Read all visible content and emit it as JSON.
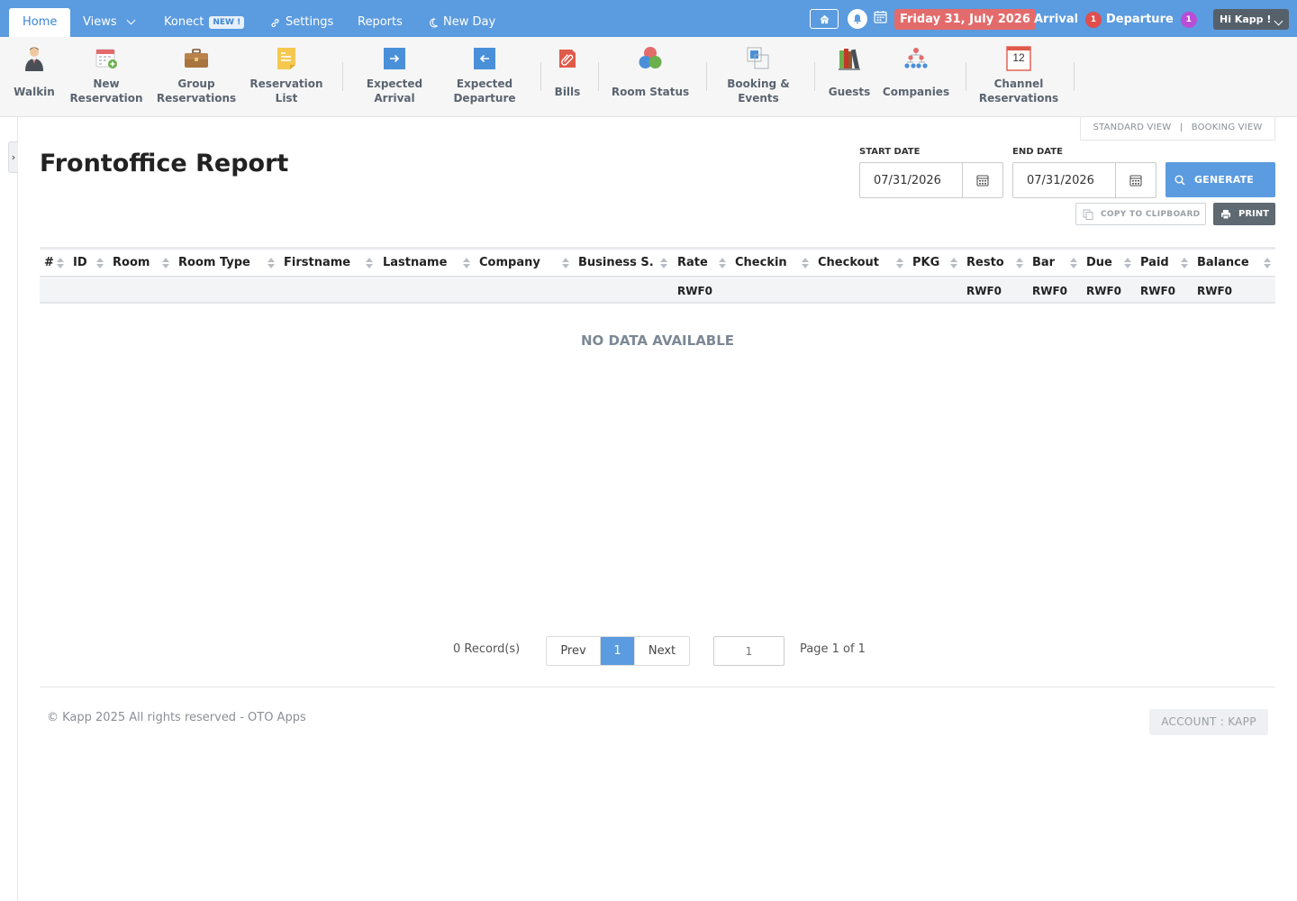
{
  "nav": {
    "tabs": [
      {
        "label": "Home"
      },
      {
        "label": "Views"
      },
      {
        "label": "Konect",
        "badge": "NEW !"
      },
      {
        "label": "Settings",
        "icon": "link-icon"
      },
      {
        "label": "Reports"
      },
      {
        "label": "New Day",
        "icon": "moon-icon"
      }
    ],
    "date": "Friday 31, July 2026",
    "arrival_label": "Arrival",
    "arrival_count": "1",
    "departure_label": "Departure",
    "departure_count": "1",
    "user": "Hi Kapp !",
    "colors": {
      "bar": "#5b9bdf",
      "date": "#e36b6b",
      "arrival": "#e04e4e",
      "departure": "#b94ed6"
    }
  },
  "toolbar": {
    "items": [
      {
        "label": "Walkin",
        "icon": "person-icon"
      },
      {
        "label": "New\nReservation",
        "icon": "calendar-add-icon"
      },
      {
        "label": "Group\nReservations",
        "icon": "briefcase-icon"
      },
      {
        "label": "Reservation\nList",
        "icon": "note-list-icon"
      },
      {
        "label": "Expected\nArrival",
        "icon": "arrow-right-icon"
      },
      {
        "label": "Expected\nDeparture",
        "icon": "arrow-left-icon"
      },
      {
        "label": "Bills",
        "icon": "paperclip-icon"
      },
      {
        "label": "Room Status",
        "icon": "color-circles-icon"
      },
      {
        "label": "Booking &\nEvents",
        "icon": "overlap-squares-icon"
      },
      {
        "label": "Guests",
        "icon": "books-icon"
      },
      {
        "label": "Companies",
        "icon": "org-chart-icon"
      },
      {
        "label": "Channel\nReservations",
        "icon": "calendar-12-icon",
        "icon_text": "12"
      }
    ]
  },
  "views": {
    "standard": "STANDARD VIEW",
    "separator": "|",
    "booking": "BOOKING VIEW"
  },
  "side_toggle": "›",
  "report": {
    "title": "Frontoffice Report",
    "start_label": "START DATE",
    "start_value": "07/31/2026",
    "end_label": "END DATE",
    "end_value": "07/31/2026",
    "generate": "GENERATE",
    "copy": "COPY TO CLIPBOARD",
    "print": "PRINT"
  },
  "table": {
    "columns": [
      "#",
      "ID",
      "Room",
      "Room Type",
      "Firstname",
      "Lastname",
      "Company",
      "Business S.",
      "Rate",
      "Checkin",
      "Checkout",
      "PKG",
      "Resto",
      "Bar",
      "Due",
      "Paid",
      "Balance"
    ],
    "totals": {
      "rate": "RWF0",
      "resto": "RWF0",
      "bar": "RWF0",
      "due": "RWF0",
      "paid": "RWF0",
      "balance": "RWF0"
    },
    "empty": "NO DATA AVAILABLE"
  },
  "pagination": {
    "records": "0 Record(s)",
    "prev": "Prev",
    "current": "1",
    "next": "Next",
    "jump_placeholder": "1",
    "page_of": "Page 1 of 1"
  },
  "footer": {
    "copyright": "© Kapp 2025 All rights reserved - OTO Apps",
    "account": "ACCOUNT : KAPP"
  }
}
